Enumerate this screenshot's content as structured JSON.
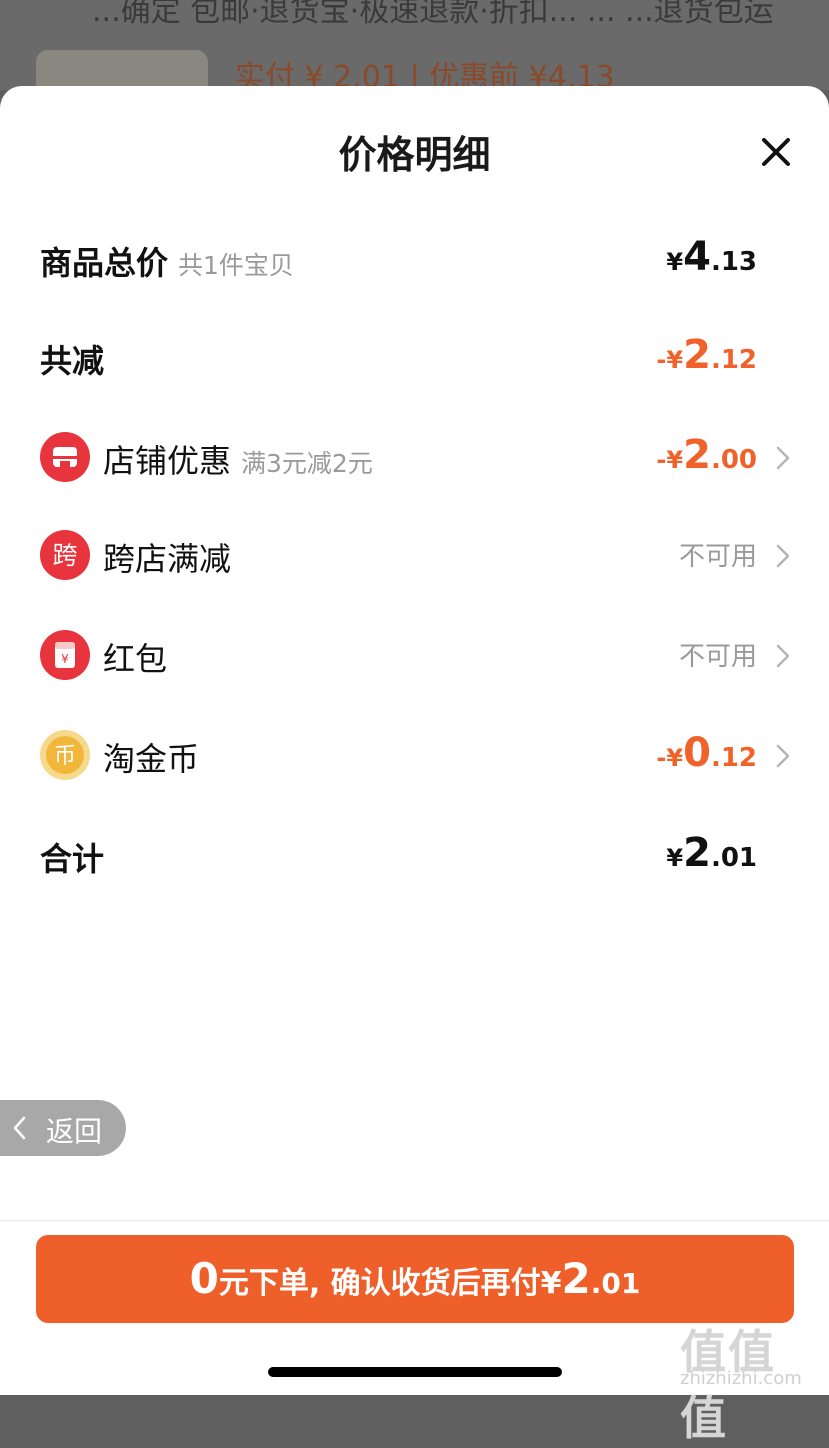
{
  "background": {
    "top_text": "...确定 包邮·退货宝·极速退款·折扣... ... ...退货包运",
    "price_line": "实付 ¥ 2.01 | 优惠前 ¥4.13"
  },
  "sheet": {
    "title": "价格明细",
    "close_icon": "close-icon"
  },
  "rows": {
    "subtotal": {
      "label": "商品总价",
      "sub": "共1件宝贝",
      "amount": {
        "prefix": "",
        "currency": "¥",
        "int": "4",
        "dec": ".13"
      }
    },
    "discount_total": {
      "label": "共减",
      "amount": {
        "prefix": "-",
        "currency": "¥",
        "int": "2",
        "dec": ".12"
      }
    },
    "store_coupon": {
      "label": "店铺优惠",
      "sub": "满3元减2元",
      "icon": "store-icon",
      "amount": {
        "prefix": "-",
        "currency": "¥",
        "int": "2",
        "dec": ".00"
      }
    },
    "cross_store": {
      "label": "跨店满减",
      "icon_text": "跨",
      "status": "不可用"
    },
    "red_packet": {
      "label": "红包",
      "icon_text": "¥",
      "status": "不可用"
    },
    "taojinbi": {
      "label": "淘金币",
      "icon_text": "币",
      "amount": {
        "prefix": "-",
        "currency": "¥",
        "int": "0",
        "dec": ".12"
      }
    },
    "total": {
      "label": "合计",
      "amount": {
        "prefix": "",
        "currency": "¥",
        "int": "2",
        "dec": ".01"
      }
    }
  },
  "back_button": {
    "label": "返回"
  },
  "pay_button": {
    "big": "0",
    "text": "元下单, 确认收货后再付",
    "currency": "¥",
    "int": "2",
    "dec": ".01"
  },
  "watermark": {
    "glyph": "值值值",
    "text": "zhizhizhi.com"
  },
  "colors": {
    "accent": "#ef5f2a",
    "discount": "#f0622a",
    "icon_red": "#e8343c",
    "coin_gold": "#f2b63a"
  }
}
